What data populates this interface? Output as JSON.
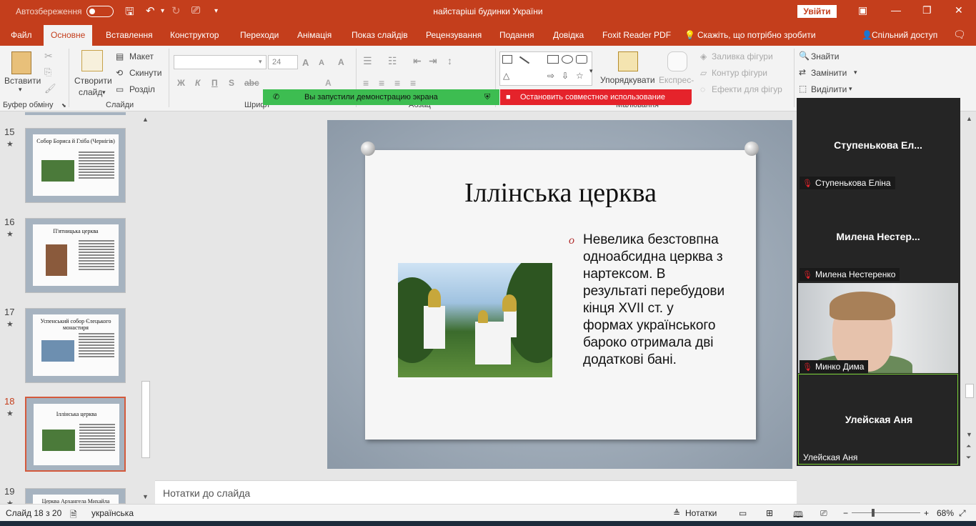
{
  "titlebar": {
    "autosave_label": "Автозбереження",
    "doc_title": "найстаріші будинки України",
    "signin": "Увійти"
  },
  "tabs": [
    "Файл",
    "Основне",
    "Вставлення",
    "Конструктор",
    "Переходи",
    "Анімація",
    "Показ слайдів",
    "Рецензування",
    "Подання",
    "Довідка",
    "Foxit Reader PDF",
    "Скажіть, що потрібно зробити",
    "Спільний доступ"
  ],
  "ribbon": {
    "paste": "Вставити",
    "new_slide_1": "Створити",
    "new_slide_2": "слайд",
    "layout": "Макет",
    "reset": "Скинути",
    "section": "Розділ",
    "font_size": "24",
    "arrange": "Упорядкувати",
    "quick_styles": "Експрес-",
    "shape_fill": "Заливка фігури",
    "shape_outline": "Контур фігури",
    "shape_effects": "Ефекти для фігур",
    "find": "Знайти",
    "replace": "Замінити",
    "select": "Виділити",
    "group_clipboard": "Буфер обміну",
    "group_slides": "Слайди",
    "group_font": "Шрифт",
    "group_paragraph": "Абзац",
    "group_drawing": "Малювання",
    "format_buttons": [
      "Ж",
      "К",
      "П",
      "S"
    ]
  },
  "share_bar": {
    "green_text": "Вы запустили демонстрацию экрана",
    "red_text": "Остановить совместное использование"
  },
  "thumbnails": [
    {
      "num": "15",
      "star": "★",
      "title": "Собор Бориса й Гліба (Чернігів)"
    },
    {
      "num": "16",
      "star": "★",
      "title": "П'ятницька церква"
    },
    {
      "num": "17",
      "star": "★",
      "title": "Успенський собор Єлецького монастиря"
    },
    {
      "num": "18",
      "star": "★",
      "title": "Іллінська церква"
    },
    {
      "num": "19",
      "star": "★",
      "title": "Церква Архангела Михайла"
    }
  ],
  "slide": {
    "title": "Іллінська церква",
    "bullet_marker": "o",
    "bullet": "Невелика безстовпна одноабсидна церква з нартексом. В результаті перебудови кінця XVII ст. у формах українського бароко отримала дві додаткові бані."
  },
  "notes_placeholder": "Нотатки до слайда",
  "participants": [
    {
      "display": "Ступенькова  Ел...",
      "tag": "Ступенькова Еліна"
    },
    {
      "display": "Милена  Нестер...",
      "tag": "Милена Нестеренко"
    },
    {
      "display": "",
      "tag": "Минко Дима"
    },
    {
      "display": "Улейская Аня",
      "tag": "Улейская Аня"
    }
  ],
  "status": {
    "slide_counter": "Слайд 18 з 20",
    "language": "українська",
    "notes_btn": "Нотатки",
    "zoom": "68%",
    "zoom_fraction": 0.68
  },
  "colors": {
    "accent": "#c43e1c",
    "share_green": "#3dbd51",
    "share_red": "#e5232b"
  }
}
